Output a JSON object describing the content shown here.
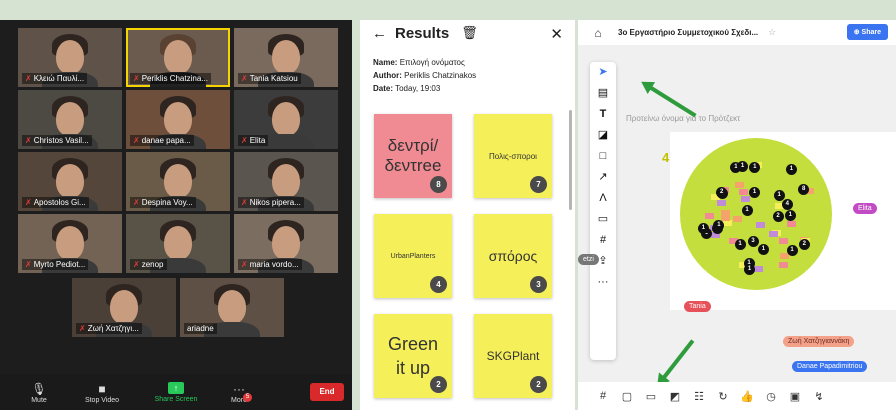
{
  "call": {
    "participants": [
      {
        "name": "Κλειώ Παυλί..."
      },
      {
        "name": "Periklis Chatzina..."
      },
      {
        "name": "Tania Katsiou"
      },
      {
        "name": "Christos Vasil..."
      },
      {
        "name": "danae papa..."
      },
      {
        "name": "Elita"
      },
      {
        "name": "Apostolos Gi..."
      },
      {
        "name": "Despina Voy..."
      },
      {
        "name": "Nikos pipera..."
      },
      {
        "name": "Myrto Pediot..."
      },
      {
        "name": "zenop"
      },
      {
        "name": "maria vordo..."
      },
      {
        "name": "Ζωή Χατζηγι..."
      },
      {
        "name": "ariadne"
      }
    ],
    "toolbar": {
      "mute": "Mute",
      "stop_video": "Stop Video",
      "share_screen": "Share Screen",
      "more": "More",
      "more_badge": "5",
      "end": "End"
    }
  },
  "results": {
    "title": "Results",
    "name_label": "Name:",
    "name_value": "Επιλογή ονόματος",
    "author_label": "Author:",
    "author_value": "Periklis Chatzinakos",
    "date_label": "Date:",
    "date_value": "Today, 19:03",
    "stickies": [
      {
        "text": "δεντρί/ δεντree",
        "count": "8",
        "color": "#f18b93"
      },
      {
        "text": "Πολις-σποροι",
        "count": "7",
        "color": "#f5ef5a"
      },
      {
        "text": "UrbanPlanters",
        "count": "4",
        "color": "#f5ef5a"
      },
      {
        "text": "σπόρος",
        "count": "3",
        "color": "#f5ef5a"
      },
      {
        "text": "Green it up",
        "count": "2",
        "color": "#f5ef5a"
      },
      {
        "text": "SKGPlant",
        "count": "2",
        "color": "#f5ef5a"
      }
    ]
  },
  "board": {
    "title": "3ο Εργαστήριο Συμμετοχικού Σχεδι...",
    "share": "Share",
    "frame_label": "Προτείνω όνομα για το Πρότζεκτ",
    "yellow_note": "4",
    "vote_dots": [
      "4",
      "1",
      "1",
      "1",
      "3",
      "1",
      "1",
      "1",
      "8",
      "1",
      "1",
      "1",
      "1",
      "1",
      "1",
      "1",
      "1",
      "2",
      "1",
      "2",
      "1",
      "1",
      "2",
      "1"
    ],
    "cursors": {
      "elita": "Elita",
      "tania": "Tania",
      "zoi": "Ζωή Χατζηγιαννάκη",
      "danae": "Danae Papadimitriou",
      "etzi": "etzi"
    }
  },
  "colors": {
    "zoom_end": "#d9292a",
    "share_green": "#28c85a",
    "miro_blue": "#3b74f0",
    "vote_circle": "#c4de3e",
    "arrow_green": "#2e9b3d"
  }
}
